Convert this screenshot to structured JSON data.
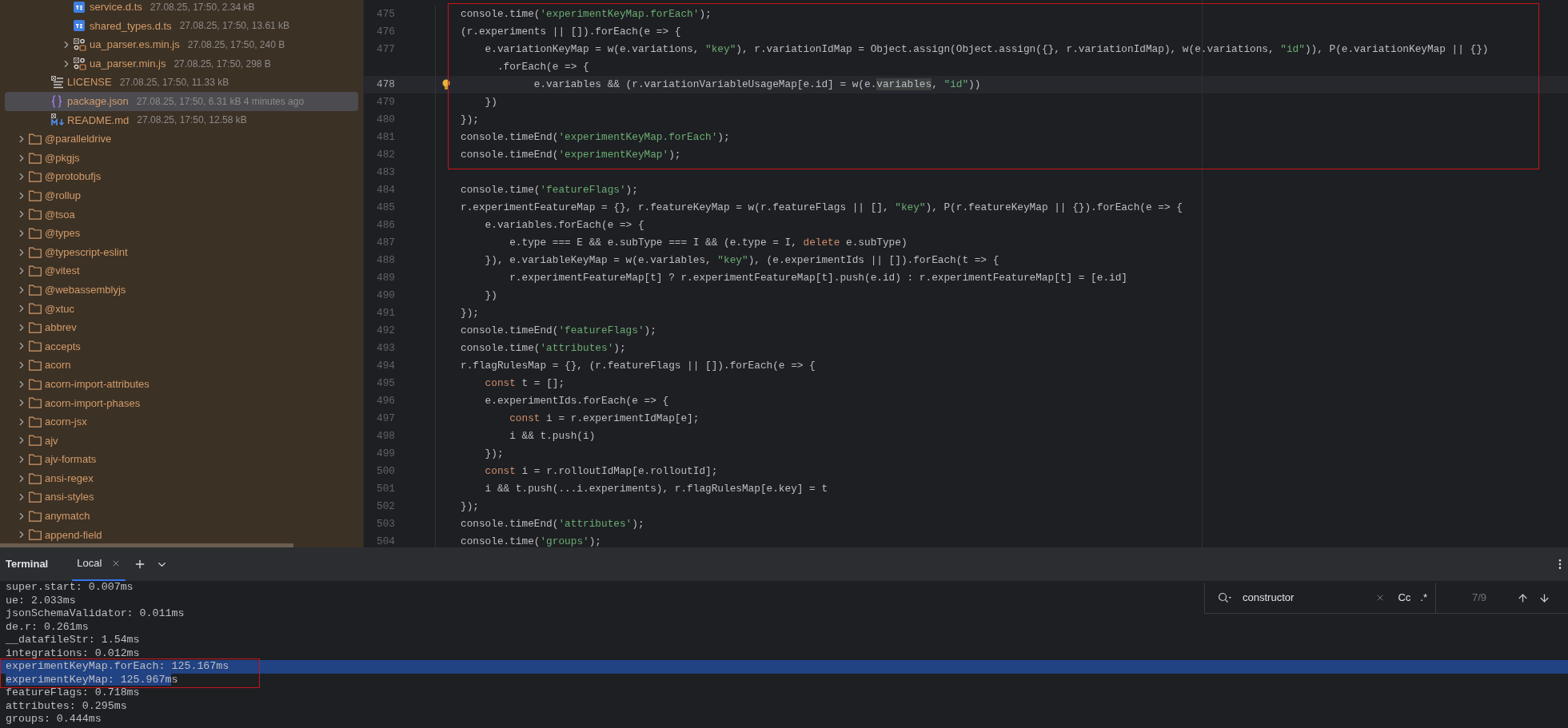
{
  "tree": [
    {
      "children": [
        {
          "children": [
            {
              "name": "service.d.ts",
              "kind": "ts",
              "meta": "27.08.25, 17:50, 2.34 kB",
              "selected": false
            },
            {
              "name": "shared_types.d.ts",
              "kind": "ts",
              "meta": "27.08.25, 17:50, 13.61 kB",
              "selected": false
            },
            {
              "name": "ua_parser.es.min.js",
              "kind": "js",
              "meta": "27.08.25, 17:50, 240 B",
              "selected": false,
              "expanded": false
            },
            {
              "name": "ua_parser.min.js",
              "kind": "js",
              "meta": "27.08.25, 17:50, 298 B",
              "selected": false,
              "expanded": false
            }
          ]
        },
        {
          "name": "LICENSE",
          "kind": "text",
          "meta": "27.08.25, 17:50, 11.33 kB",
          "selected": false
        },
        {
          "name": "package.json",
          "kind": "json",
          "meta": "27.08.25, 17:50, 6.31 kB 4 minutes ago",
          "selected": true
        },
        {
          "name": "README.md",
          "kind": "md",
          "meta": "27.08.25, 17:50, 12.58 kB",
          "selected": false
        }
      ]
    },
    {
      "name": "@paralleldrive",
      "kind": "folder",
      "selected": false,
      "expanded": false
    },
    {
      "name": "@pkgjs",
      "kind": "folder",
      "selected": false,
      "expanded": false
    },
    {
      "name": "@protobufjs",
      "kind": "folder",
      "selected": false,
      "expanded": false
    },
    {
      "name": "@rollup",
      "kind": "folder",
      "selected": false,
      "expanded": false
    },
    {
      "name": "@tsoa",
      "kind": "folder",
      "selected": false,
      "expanded": false
    },
    {
      "name": "@types",
      "kind": "folder",
      "selected": false,
      "expanded": false
    },
    {
      "name": "@typescript-eslint",
      "kind": "folder",
      "selected": false,
      "expanded": false
    },
    {
      "name": "@vitest",
      "kind": "folder",
      "selected": false,
      "expanded": false
    },
    {
      "name": "@webassemblyjs",
      "kind": "folder",
      "selected": false,
      "expanded": false
    },
    {
      "name": "@xtuc",
      "kind": "folder",
      "selected": false,
      "expanded": false
    },
    {
      "name": "abbrev",
      "kind": "folder",
      "selected": false,
      "expanded": false
    },
    {
      "name": "accepts",
      "kind": "folder",
      "selected": false,
      "expanded": false
    },
    {
      "name": "acorn",
      "kind": "folder",
      "selected": false,
      "expanded": false
    },
    {
      "name": "acorn-import-attributes",
      "kind": "folder",
      "selected": false,
      "expanded": false
    },
    {
      "name": "acorn-import-phases",
      "kind": "folder",
      "selected": false,
      "expanded": false
    },
    {
      "name": "acorn-jsx",
      "kind": "folder",
      "selected": false,
      "expanded": false
    },
    {
      "name": "ajv",
      "kind": "folder",
      "selected": false,
      "expanded": false
    },
    {
      "name": "ajv-formats",
      "kind": "folder",
      "selected": false,
      "expanded": false
    },
    {
      "name": "ansi-regex",
      "kind": "folder",
      "selected": false,
      "expanded": false
    },
    {
      "name": "ansi-styles",
      "kind": "folder",
      "selected": false,
      "expanded": false
    },
    {
      "name": "anymatch",
      "kind": "folder",
      "selected": false,
      "expanded": false
    },
    {
      "name": "append-field",
      "kind": "folder",
      "selected": false,
      "expanded": false
    }
  ],
  "editor": {
    "lines": [
      {
        "number": "475",
        "current": false,
        "segments": [
          {
            "kind": "plain",
            "text": "console.time("
          },
          {
            "kind": "string",
            "text": "'experimentKeyMap.forEach'"
          },
          {
            "kind": "plain",
            "text": ");"
          }
        ]
      },
      {
        "number": "476",
        "current": false,
        "segments": [
          {
            "kind": "plain",
            "text": "(r.experiments || []).forEach(e => {"
          }
        ]
      },
      {
        "number": "477",
        "current": false,
        "segments": [
          {
            "kind": "plain",
            "text": "    e.variationKeyMap = w(e.variations, "
          },
          {
            "kind": "string",
            "text": "\"key\""
          },
          {
            "kind": "plain",
            "text": "), r.variationIdMap = Object.assign(Object.assign({}, r.variationIdMap), w(e.variations, "
          },
          {
            "kind": "string",
            "text": "\"id\""
          },
          {
            "kind": "plain",
            "text": ")), P(e.variationKeyMap || {})"
          }
        ]
      },
      {
        "current": false,
        "segments": [
          {
            "kind": "plain",
            "text": "      .forEach(e => {"
          }
        ]
      },
      {
        "number": "478",
        "current": true,
        "hint": true,
        "segments": [
          {
            "kind": "plain",
            "text": "            e.variables && (r.variationVariableUsageMap[e.id] = w(e."
          },
          {
            "kind": "match",
            "text": "variables"
          },
          {
            "kind": "plain",
            "text": ", "
          },
          {
            "kind": "string",
            "text": "\"id\""
          },
          {
            "kind": "plain",
            "text": "))"
          }
        ]
      },
      {
        "number": "479",
        "current": false,
        "segments": [
          {
            "kind": "plain",
            "text": "    })"
          }
        ]
      },
      {
        "number": "480",
        "current": false,
        "segments": [
          {
            "kind": "plain",
            "text": "});"
          }
        ]
      },
      {
        "number": "481",
        "current": false,
        "segments": [
          {
            "kind": "plain",
            "text": "console.timeEnd("
          },
          {
            "kind": "string",
            "text": "'experimentKeyMap.forEach'"
          },
          {
            "kind": "plain",
            "text": ");"
          }
        ]
      },
      {
        "number": "482",
        "current": false,
        "segments": [
          {
            "kind": "plain",
            "text": "console.timeEnd("
          },
          {
            "kind": "string",
            "text": "'experimentKeyMap'"
          },
          {
            "kind": "plain",
            "text": ");"
          }
        ]
      },
      {
        "number": "483",
        "current": false
      },
      {
        "number": "484",
        "current": false,
        "segments": [
          {
            "kind": "plain",
            "text": "console.time("
          },
          {
            "kind": "string",
            "text": "'featureFlags'"
          },
          {
            "kind": "plain",
            "text": ");"
          }
        ]
      },
      {
        "number": "485",
        "current": false,
        "segments": [
          {
            "kind": "plain",
            "text": "r.experimentFeatureMap = {}, r.featureKeyMap = w(r.featureFlags || [], "
          },
          {
            "kind": "string",
            "text": "\"key\""
          },
          {
            "kind": "plain",
            "text": "), P(r.featureKeyMap || {}).forEach(e => {"
          }
        ]
      },
      {
        "number": "486",
        "current": false,
        "segments": [
          {
            "kind": "plain",
            "text": "    e.variables.forEach(e => {"
          }
        ]
      },
      {
        "number": "487",
        "current": false,
        "segments": [
          {
            "kind": "plain",
            "text": "        e.type === E && e.subType === I && (e.type = I, "
          },
          {
            "kind": "keyword",
            "text": "delete"
          },
          {
            "kind": "plain",
            "text": " e.subType)"
          }
        ]
      },
      {
        "number": "488",
        "current": false,
        "segments": [
          {
            "kind": "plain",
            "text": "    }), e.variableKeyMap = w(e.variables, "
          },
          {
            "kind": "string",
            "text": "\"key\""
          },
          {
            "kind": "plain",
            "text": "), (e.experimentIds || []).forEach(t => {"
          }
        ]
      },
      {
        "number": "489",
        "current": false,
        "segments": [
          {
            "kind": "plain",
            "text": "        r.experimentFeatureMap[t] ? r.experimentFeatureMap[t].push(e.id) : r.experimentFeatureMap[t] = [e.id]"
          }
        ]
      },
      {
        "number": "490",
        "current": false,
        "segments": [
          {
            "kind": "plain",
            "text": "    })"
          }
        ]
      },
      {
        "number": "491",
        "current": false,
        "segments": [
          {
            "kind": "plain",
            "text": "});"
          }
        ]
      },
      {
        "number": "492",
        "current": false,
        "segments": [
          {
            "kind": "plain",
            "text": "console.timeEnd("
          },
          {
            "kind": "string",
            "text": "'featureFlags'"
          },
          {
            "kind": "plain",
            "text": ");"
          }
        ]
      },
      {
        "number": "493",
        "current": false,
        "segments": [
          {
            "kind": "plain",
            "text": "console.time("
          },
          {
            "kind": "string",
            "text": "'attributes'"
          },
          {
            "kind": "plain",
            "text": ");"
          }
        ]
      },
      {
        "number": "494",
        "current": false,
        "segments": [
          {
            "kind": "plain",
            "text": "r.flagRulesMap = {}, (r.featureFlags || []).forEach(e => {"
          }
        ]
      },
      {
        "number": "495",
        "current": false,
        "segments": [
          {
            "kind": "keyword",
            "text": "    const"
          },
          {
            "kind": "plain",
            "text": " t = [];"
          }
        ]
      },
      {
        "number": "496",
        "current": false,
        "segments": [
          {
            "kind": "plain",
            "text": "    e.experimentIds.forEach(e => {"
          }
        ]
      },
      {
        "number": "497",
        "current": false,
        "segments": [
          {
            "kind": "keyword",
            "text": "        const"
          },
          {
            "kind": "plain",
            "text": " i = r.experimentIdMap[e];"
          }
        ]
      },
      {
        "number": "498",
        "current": false,
        "segments": [
          {
            "kind": "plain",
            "text": "        i && t.push(i)"
          }
        ]
      },
      {
        "number": "499",
        "current": false,
        "segments": [
          {
            "kind": "plain",
            "text": "    });"
          }
        ]
      },
      {
        "number": "500",
        "current": false,
        "segments": [
          {
            "kind": "keyword",
            "text": "    const"
          },
          {
            "kind": "plain",
            "text": " i = r.rolloutIdMap[e.rolloutId];"
          }
        ]
      },
      {
        "number": "501",
        "current": false,
        "segments": [
          {
            "kind": "plain",
            "text": "    i && t.push(...i.experiments), r.flagRulesMap[e.key] = t"
          }
        ]
      },
      {
        "number": "502",
        "current": false,
        "segments": [
          {
            "kind": "plain",
            "text": "});"
          }
        ]
      },
      {
        "number": "503",
        "current": false,
        "segments": [
          {
            "kind": "plain",
            "text": "console.timeEnd("
          },
          {
            "kind": "string",
            "text": "'attributes'"
          },
          {
            "kind": "plain",
            "text": ");"
          }
        ]
      },
      {
        "number": "504",
        "current": false,
        "segments": [
          {
            "kind": "plain",
            "text": "console.time("
          },
          {
            "kind": "string",
            "text": "'groups'"
          },
          {
            "kind": "plain",
            "text": ");"
          }
        ]
      }
    ]
  },
  "terminal": {
    "title": "Terminal",
    "tabs": [
      {
        "label": "Local",
        "selected": true
      }
    ],
    "lines": [
      {
        "selected": false,
        "text": "super.start: 0.007ms"
      },
      {
        "selected": false,
        "text": "ue: 2.033ms"
      },
      {
        "selected": false,
        "text": "jsonSchemaValidator: 0.011ms"
      },
      {
        "selected": false,
        "text": "de.r: 0.261ms"
      },
      {
        "selected": false,
        "text": "__datafileStr: 1.54ms"
      },
      {
        "selected": false,
        "text": "integrations: 0.012ms"
      },
      {
        "selected": true,
        "text": "experimentKeyMap.forEach: 125.167ms"
      },
      {
        "selected": false,
        "segments": [
          {
            "text": "experimentKeyMap: 125.967m",
            "selected": true
          },
          {
            "text": "s",
            "selected": false
          }
        ]
      },
      {
        "selected": false,
        "text": "featureFlags: 0.718ms"
      },
      {
        "selected": false,
        "text": "attributes: 0.295ms"
      },
      {
        "selected": false,
        "text": "groups: 0.444ms"
      }
    ],
    "search": {
      "value": "constructor",
      "match_case": "Cc",
      "regex": ".*",
      "count": "7/9"
    }
  }
}
